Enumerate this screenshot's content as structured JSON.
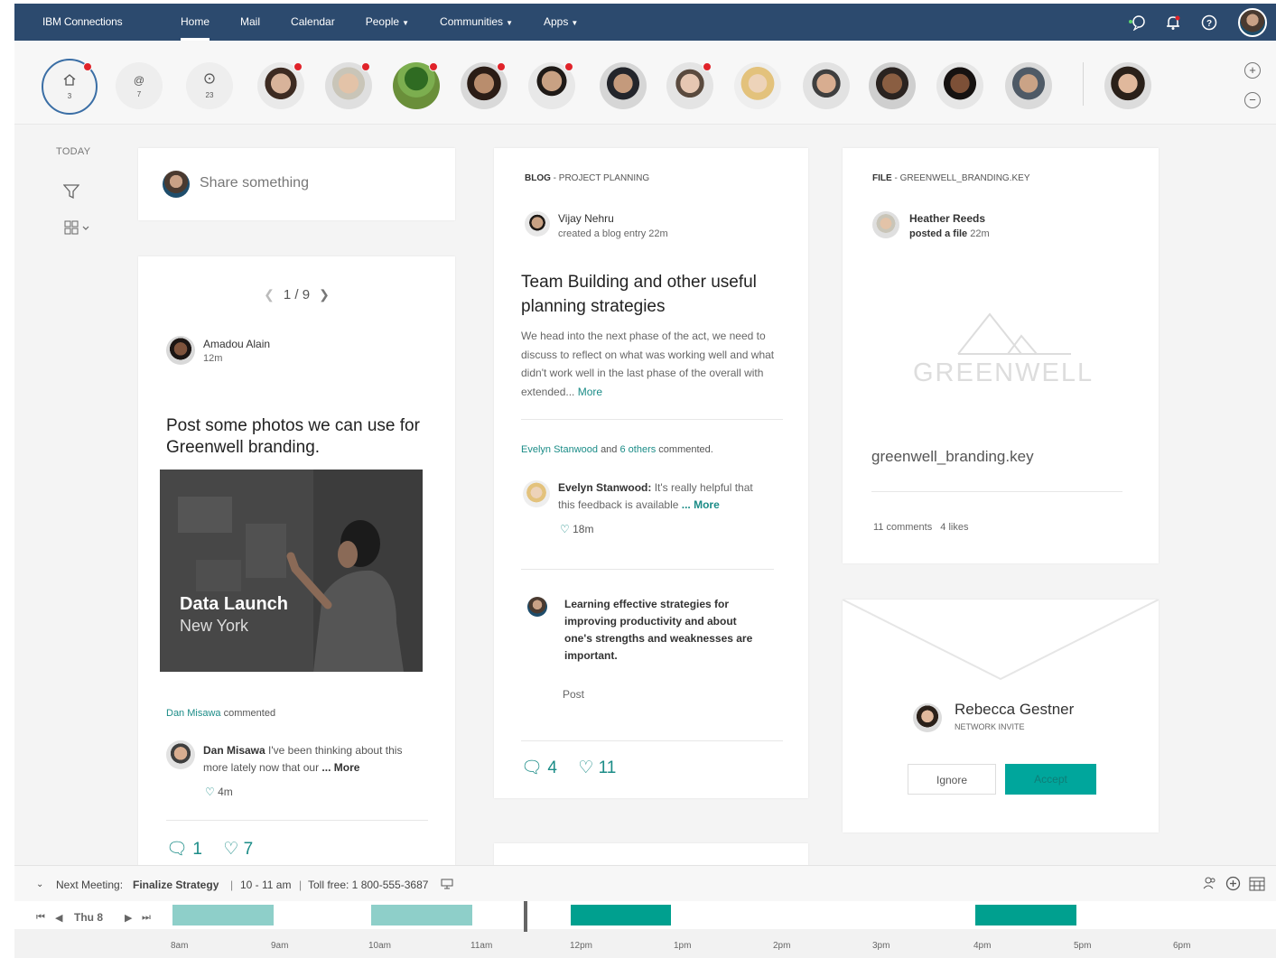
{
  "nav": {
    "brand": "IBM Connections",
    "items": [
      {
        "label": "Home",
        "active": true,
        "caret": false
      },
      {
        "label": "Mail",
        "active": false,
        "caret": false
      },
      {
        "label": "Calendar",
        "active": false,
        "caret": false
      },
      {
        "label": "People",
        "active": false,
        "caret": true
      },
      {
        "label": "Communities",
        "active": false,
        "caret": true
      },
      {
        "label": "Apps",
        "active": false,
        "caret": true
      }
    ],
    "icons": [
      "chat-status-icon",
      "bell-icon",
      "help-icon"
    ]
  },
  "strip": {
    "tiles": [
      {
        "icon": "home-icon",
        "count": "3"
      },
      {
        "icon": "at-mention-icon",
        "count": "7"
      },
      {
        "icon": "chat-icon",
        "count": "23"
      }
    ]
  },
  "sidebar": {
    "today": "TODAY"
  },
  "share": {
    "placeholder": "Share something"
  },
  "post_card": {
    "pager": "1 / 9",
    "author": "Amadou Alain",
    "time": "12m",
    "text": "Post some photos we can use for Greenwell branding.",
    "photo_title": "Data Launch",
    "photo_subtitle": "New York",
    "commenter": "Dan Misawa",
    "commented_label": "commented",
    "comment_author": "Dan Misawa",
    "comment_text": "I've been thinking about this more lately now that our",
    "comment_more": "... More",
    "comment_likes": "4m",
    "comments_count": "1",
    "likes_count": "7"
  },
  "blog_card": {
    "type": "BLOG",
    "context": "PROJECT PLANNING",
    "author": "Vijay Nehru",
    "action": "created a blog entry",
    "time": "22m",
    "title": "Team Building and other useful planning strategies",
    "excerpt": "We head into the next phase of the act, we need to discuss to reflect on what was working well and what didn't work well in the last phase of the overall with extended...",
    "excerpt_more": "More",
    "activity_user": "Evelyn Stanwood",
    "activity_and": "and",
    "activity_others": "6 others",
    "activity_verb": "commented.",
    "comment_author": "Evelyn Stanwood:",
    "comment_text": "It's really helpful that this feedback is available",
    "comment_more": "... More",
    "comment_time": "18m",
    "reply_text": "Learning effective strategies for improving productivity and about one's strengths and weaknesses are important.",
    "post_label": "Post",
    "comments_count": "4",
    "likes_count": "11"
  },
  "file_card": {
    "type": "FILE",
    "context": "GREENWELL_BRANDING.KEY",
    "author": "Heather Reeds",
    "action": "posted a file",
    "time": "22m",
    "logo_text": "GREENWELL",
    "filename": "greenwell_branding.key",
    "comments": "11 comments",
    "likes": "4 likes"
  },
  "invite_card": {
    "name": "Rebecca Gestner",
    "label": "NETWORK INVITE",
    "ignore": "Ignore",
    "accept": "Accept"
  },
  "calendar": {
    "next_label": "Next Meeting:",
    "meeting": "Finalize Strategy",
    "time": "10 - 11 am",
    "tollfree": "Toll free: 1 800-555-3687",
    "day": "Thu 8",
    "hours": [
      "8am",
      "9am",
      "10am",
      "11am",
      "12pm",
      "1pm",
      "2pm",
      "3pm",
      "4pm",
      "5pm",
      "6pm"
    ]
  },
  "colors": {
    "nav_bg": "#2c4a6e",
    "accent_teal": "#00a69c",
    "slot_light": "#8ecfc9",
    "slot_dark": "#00a08f",
    "notify_red": "#e0232a"
  }
}
